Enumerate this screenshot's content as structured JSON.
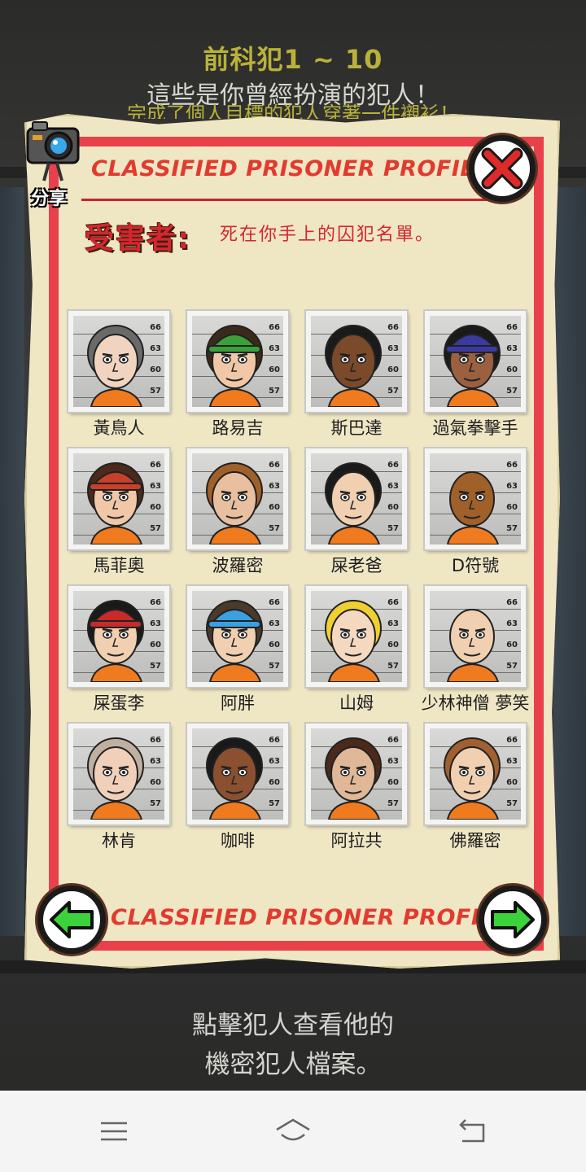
{
  "header": {
    "title": "前科犯1 ~ 10",
    "subtitle": "這些是你曾經扮演的犯人！",
    "subtitle2": "完成了個人目標的犯人穿著一件襯衫！"
  },
  "share": {
    "label": "分享"
  },
  "profile": {
    "heading": "CLASSIFIED PRISONER PROFILE",
    "footer": "CLASSIFIED PRISONER PROFILE",
    "victim_label": "受害者:",
    "victim_desc": "死在你手上的囚犯名單。"
  },
  "mugshot_scale": [
    "66",
    "63",
    "60",
    "57"
  ],
  "prisoners": [
    {
      "name": "黃鳥人",
      "hair": "#6a6a6a",
      "skin": "#f0d4c0",
      "hat": null
    },
    {
      "name": "路易吉",
      "hair": "#3a2a1a",
      "skin": "#f0c8a8",
      "hat": "#3aa03a"
    },
    {
      "name": "斯巴達",
      "hair": "#1a1a1a",
      "skin": "#7a4a2a",
      "hat": null
    },
    {
      "name": "過氣拳擊手",
      "hair": "#1a1a1a",
      "skin": "#9a6040",
      "hat": "#3a3aa0"
    },
    {
      "name": "馬菲奧",
      "hair": "#4a2a1a",
      "skin": "#f0c8a8",
      "hat": "#c8402a"
    },
    {
      "name": "波羅密",
      "hair": "#a0602a",
      "skin": "#e8c0a0",
      "hat": null
    },
    {
      "name": "屎老爸",
      "hair": "#1a1a1a",
      "skin": "#f0d0b0",
      "hat": null
    },
    {
      "name": "D符號",
      "hair": null,
      "skin": "#a0602a",
      "hat": null
    },
    {
      "name": "屎蛋李",
      "hair": "#1a1a1a",
      "skin": "#f0d0b0",
      "hat": "#c82a2a"
    },
    {
      "name": "阿胖",
      "hair": "#4a3a2a",
      "skin": "#f0d0b0",
      "hat": "#3aa0e0"
    },
    {
      "name": "山姆",
      "hair": "#f0d030",
      "skin": "#f4d8c0",
      "hat": null
    },
    {
      "name": "少林神僧 夢笑",
      "hair": null,
      "skin": "#f0d0b0",
      "hat": null
    },
    {
      "name": "林肯",
      "hair": "#c0b0a0",
      "skin": "#f0d0b8",
      "hat": null
    },
    {
      "name": "咖啡",
      "hair": "#1a1a1a",
      "skin": "#8a5030",
      "hat": null
    },
    {
      "name": "阿拉共",
      "hair": "#4a2a1a",
      "skin": "#e0b898",
      "hat": null
    },
    {
      "name": "佛羅密",
      "hair": "#a06030",
      "skin": "#f0d0b0",
      "hat": null
    }
  ],
  "hint": {
    "line1": "點擊犯人查看他的",
    "line2": "機密犯人檔案。"
  },
  "colors": {
    "frame_red": "#e8414c",
    "paper": "#efe6c4",
    "arrow_green": "#3cd23c",
    "title_yellow": "#b8b23a"
  }
}
